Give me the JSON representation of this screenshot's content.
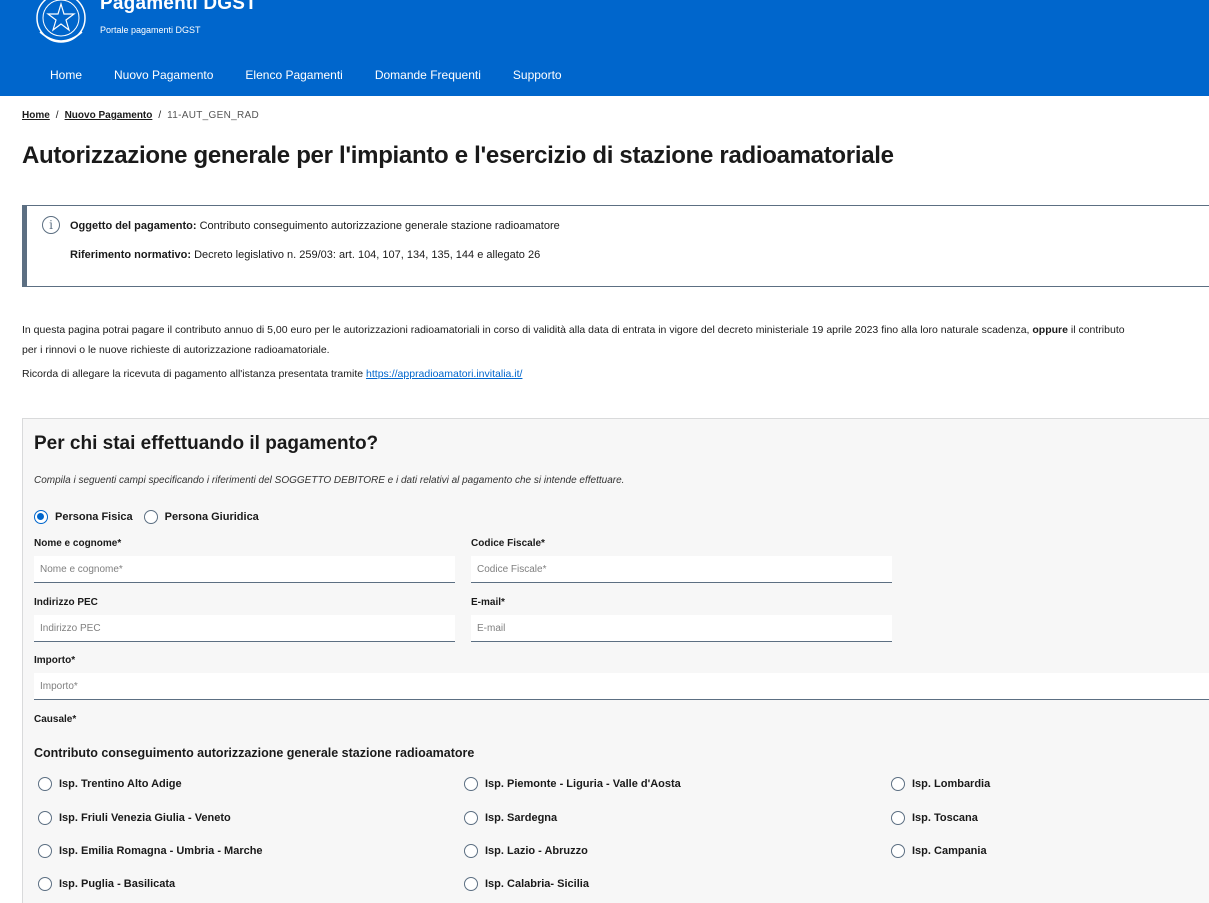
{
  "header": {
    "title": "Pagamenti DGST",
    "subtitle": "Portale pagamenti DGST",
    "nav": [
      "Home",
      "Nuovo Pagamento",
      "Elenco Pagamenti",
      "Domande Frequenti",
      "Supporto"
    ],
    "color": "#0066cc"
  },
  "breadcrumb": {
    "home": "Home",
    "parent": "Nuovo Pagamento",
    "current": "11-AUT_GEN_RAD",
    "separator": "/"
  },
  "page_title": "Autorizzazione generale per l'impianto e l'esercizio di stazione radioamatoriale",
  "callout": {
    "icon": "info-icon",
    "oggetto_label": "Oggetto del pagamento:",
    "oggetto_value": "Contributo conseguimento autorizzazione generale stazione radioamatore",
    "riferimento_label": "Riferimento normativo:",
    "riferimento_value": "Decreto legislativo n. 259/03: art. 104, 107, 134, 135, 144 e allegato 26"
  },
  "intro": {
    "line1_a": "In questa pagina potrai pagare il contributo annuo di 5,00 euro per le autorizzazioni radioamatoriali in corso di validità alla data di entrata in vigore del decreto ministeriale 19 aprile 2023 fino alla loro naturale scadenza, ",
    "line1_bold": "oppure",
    "line1_b": " il contributo",
    "line2": "per i rinnovi o le nuove richieste di autorizzazione radioamatoriale.",
    "reminder_text": "Ricorda di allegare la ricevuta di pagamento all'istanza presentata tramite ",
    "reminder_link": "https://appradioamatori.invitalia.it/"
  },
  "form": {
    "title": "Per chi stai effettuando il pagamento?",
    "hint": "Compila i seguenti campi specificando i riferimenti del SOGGETTO DEBITORE e i dati relativi al pagamento che si intende effettuare.",
    "subject_types": [
      {
        "label": "Persona Fisica",
        "checked": true
      },
      {
        "label": "Persona Giuridica",
        "checked": false
      }
    ],
    "nome": {
      "label": "Nome e cognome*",
      "placeholder": "Nome e cognome*"
    },
    "cf": {
      "label": "Codice Fiscale*",
      "placeholder": "Codice Fiscale*"
    },
    "pec": {
      "label": "Indirizzo PEC",
      "placeholder": "Indirizzo PEC"
    },
    "email": {
      "label": "E-mail*",
      "placeholder": "E-mail"
    },
    "importo": {
      "label": "Importo*",
      "placeholder": "Importo*"
    },
    "causale": {
      "label": "Causale*"
    },
    "section_title": "Contributo conseguimento autorizzazione generale stazione radioamatore",
    "options": [
      "Isp. Trentino Alto Adige",
      "Isp. Piemonte - Liguria - Valle d'Aosta",
      "Isp. Lombardia",
      "Isp. Friuli Venezia Giulia - Veneto",
      "Isp. Sardegna",
      "Isp. Toscana",
      "Isp. Emilia Romagna - Umbria - Marche",
      "Isp. Lazio - Abruzzo",
      "Isp. Campania",
      "Isp. Puglia - Basilicata",
      "Isp. Calabria- Sicilia"
    ]
  }
}
